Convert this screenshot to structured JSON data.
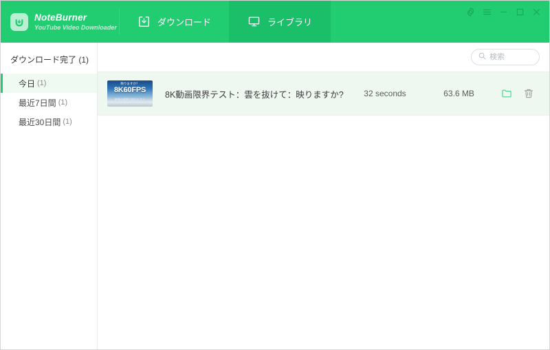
{
  "app": {
    "brand_title": "NoteBurner",
    "brand_subtitle": "YouTube Video Downloader",
    "brand_logo_icon": "download-box-icon"
  },
  "header": {
    "tabs": [
      {
        "label": "ダウンロード",
        "icon": "download-tray-icon",
        "active": false
      },
      {
        "label": "ライブラリ",
        "icon": "monitor-icon",
        "active": true
      }
    ],
    "window_controls": [
      {
        "name": "settings-gear",
        "glyph": "gear-icon"
      },
      {
        "name": "menu",
        "glyph": "hamburger-icon"
      },
      {
        "name": "minimize",
        "glyph": "minimize-icon"
      },
      {
        "name": "maximize",
        "glyph": "maximize-icon"
      },
      {
        "name": "close",
        "glyph": "close-icon"
      }
    ]
  },
  "sidebar": {
    "heading": "ダウンロード完了 (1)",
    "items": [
      {
        "label": "今日",
        "count": "(1)",
        "active": true
      },
      {
        "label": "最近7日間",
        "count": "(1)",
        "active": false
      },
      {
        "label": "最近30日間",
        "count": "(1)",
        "active": false
      }
    ]
  },
  "search": {
    "placeholder": "検索",
    "value": "",
    "icon": "search-icon"
  },
  "library": {
    "rows": [
      {
        "title": "8K動画限界テスト：雲を抜けて：映りますか?",
        "duration": "32 seconds",
        "size": "63.6 MB",
        "thumbnail": {
          "top_text": "映りますか？",
          "main_text": "8K60FPS",
          "sub_text": "映像の限界に挑むテスト"
        },
        "actions": [
          {
            "name": "open-folder",
            "icon": "folder-icon"
          },
          {
            "name": "delete",
            "icon": "trash-icon"
          }
        ]
      }
    ]
  },
  "colors": {
    "brand_green": "#22cd72",
    "active_tab_green": "#1cbf69",
    "row_highlight": "#eef8f1",
    "accent_icon": "#4cd08a"
  }
}
